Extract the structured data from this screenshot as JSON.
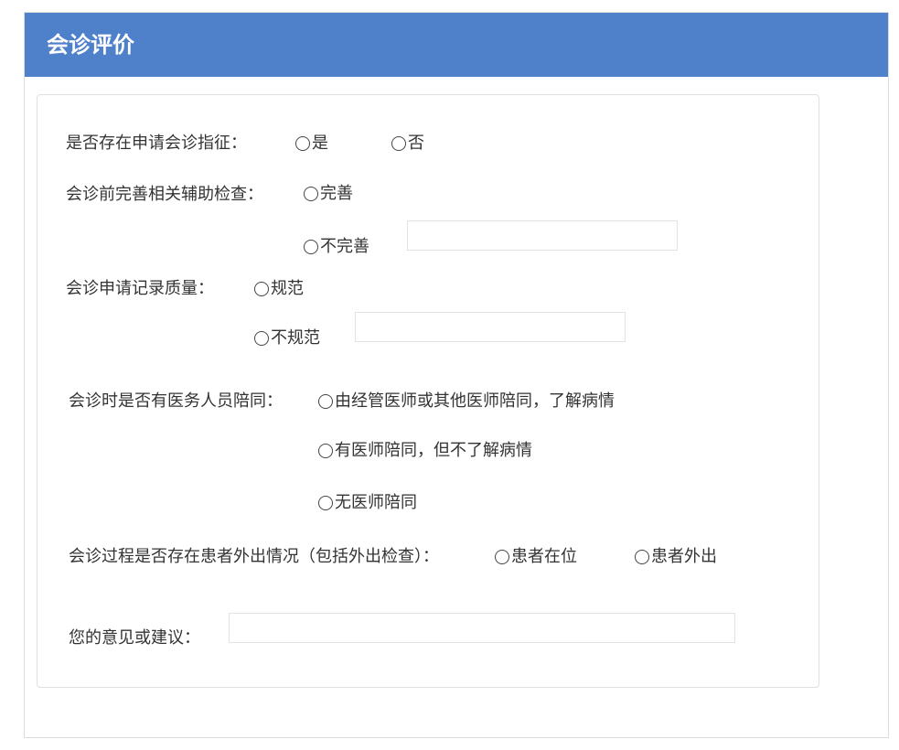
{
  "header": {
    "title": "会诊评价"
  },
  "form": {
    "q1": {
      "label": "是否存在申请会诊指征：",
      "options": [
        "是",
        "否"
      ]
    },
    "q2": {
      "label": "会诊前完善相关辅助检查：",
      "options": [
        "完善",
        "不完善"
      ],
      "input_value": ""
    },
    "q3": {
      "label": "会诊申请记录质量：",
      "options": [
        "规范",
        "不规范"
      ],
      "input_value": ""
    },
    "q4": {
      "label": "会诊时是否有医务人员陪同：",
      "options": [
        "由经管医师或其他医师陪同，了解病情",
        "有医师陪同，但不了解病情",
        "无医师陪同"
      ]
    },
    "q5": {
      "label": "会诊过程是否存在患者外出情况（包括外出检查）：",
      "options": [
        "患者在位",
        "患者外出"
      ]
    },
    "q6": {
      "label": "您的意见或建议：",
      "input_value": ""
    }
  },
  "colors": {
    "header_bg": "#4f81cb",
    "header_text": "#ffffff",
    "border": "#e0e0e0"
  }
}
